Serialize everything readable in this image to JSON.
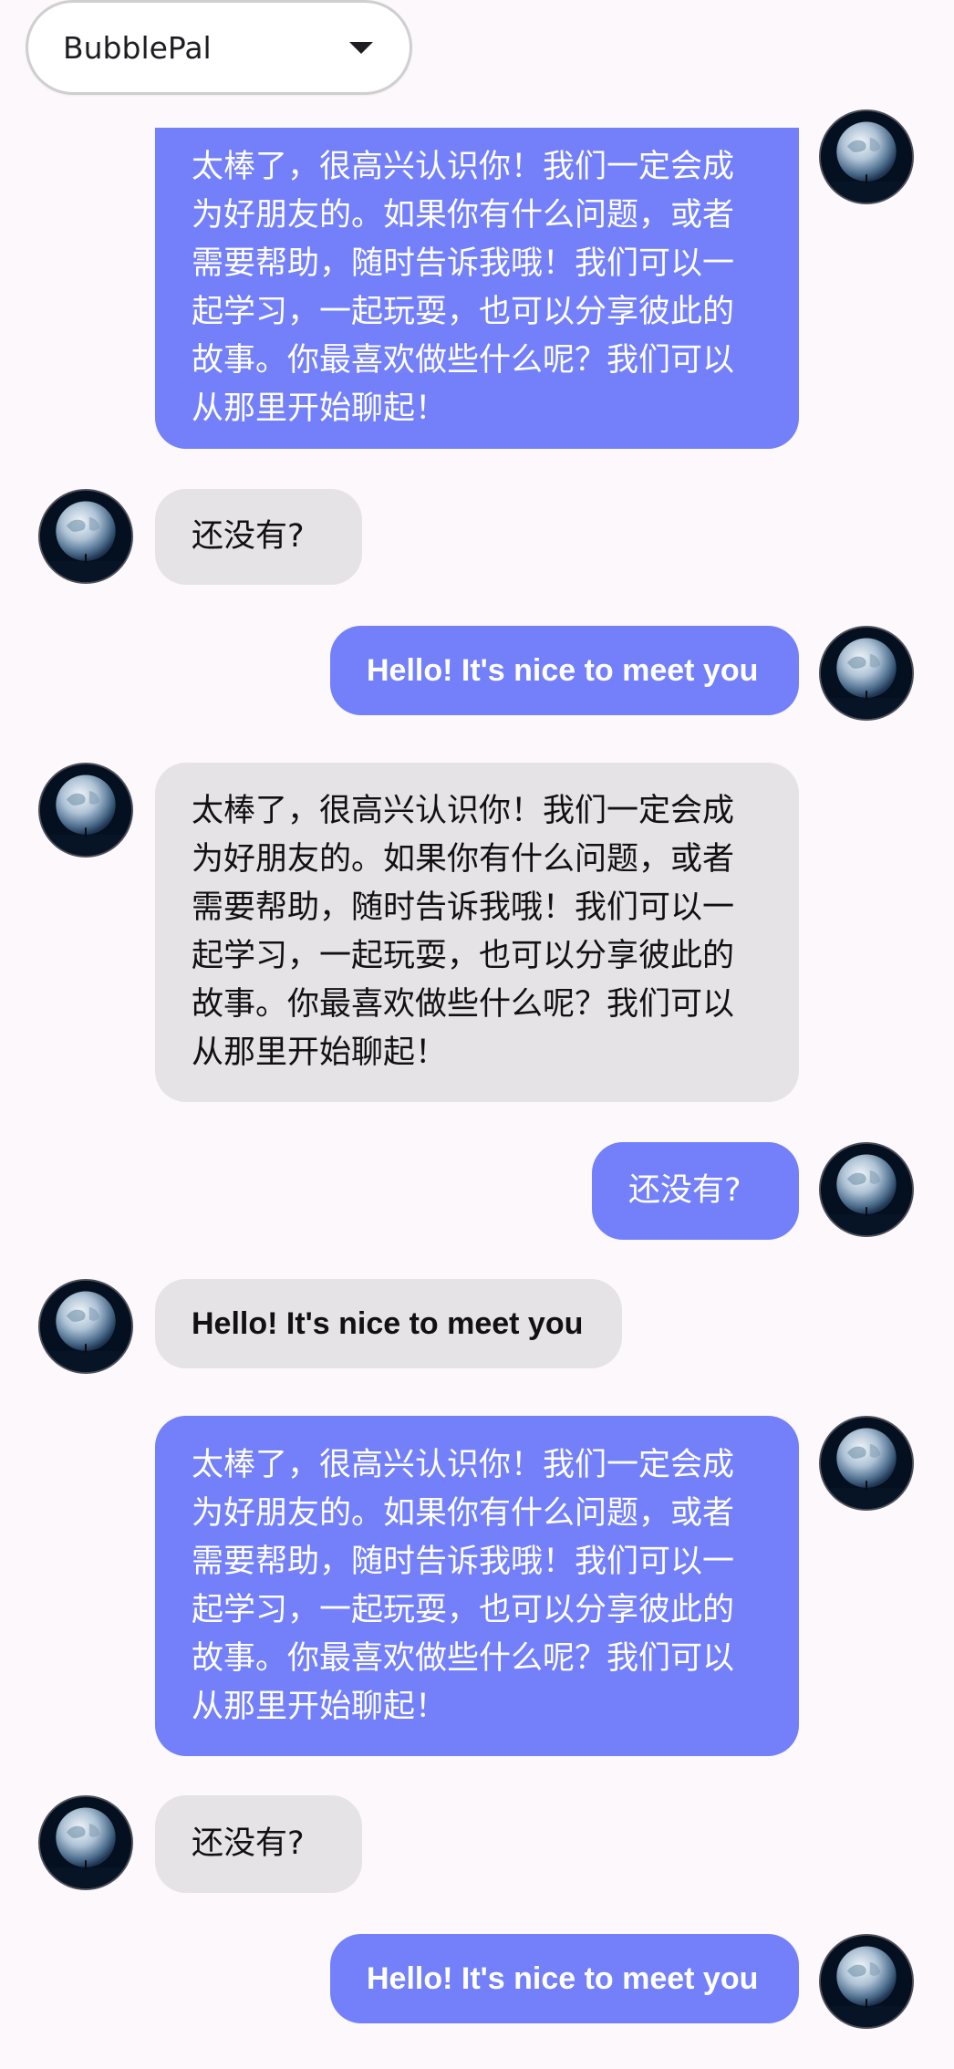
{
  "header": {
    "bot_selector": {
      "value": "BubblePal",
      "icon": "caret-down-icon"
    }
  },
  "colors": {
    "sent_bubble": "#7380FA",
    "received_bubble": "#E6E3E6",
    "background": "#FCF8FC"
  },
  "messages": [
    {
      "sender": "user",
      "text": "太棒了，很高兴认识你！我们一定会成为好朋友的。如果你有什么问题，或者需要帮助，随时告诉我哦！我们可以一起学习，一起玩耍，也可以分享彼此的故事。你最喜欢做些什么呢？我们可以从那里开始聊起！"
    },
    {
      "sender": "bot",
      "text": "还没有?"
    },
    {
      "sender": "user",
      "text": "Hello! It's nice to meet you"
    },
    {
      "sender": "bot",
      "text": "太棒了，很高兴认识你！我们一定会成为好朋友的。如果你有什么问题，或者需要帮助，随时告诉我哦！我们可以一起学习，一起玩耍，也可以分享彼此的故事。你最喜欢做些什么呢？我们可以从那里开始聊起！"
    },
    {
      "sender": "user",
      "text": "还没有?"
    },
    {
      "sender": "bot",
      "text": "Hello! It's nice to meet you"
    },
    {
      "sender": "user",
      "text": "太棒了，很高兴认识你！我们一定会成为好朋友的。如果你有什么问题，或者需要帮助，随时告诉我哦！我们可以一起学习，一起玩耍，也可以分享彼此的故事。你最喜欢做些什么呢？我们可以从那里开始聊起！"
    },
    {
      "sender": "bot",
      "text": "还没有?"
    },
    {
      "sender": "user",
      "text": "Hello! It's nice to meet you"
    }
  ]
}
